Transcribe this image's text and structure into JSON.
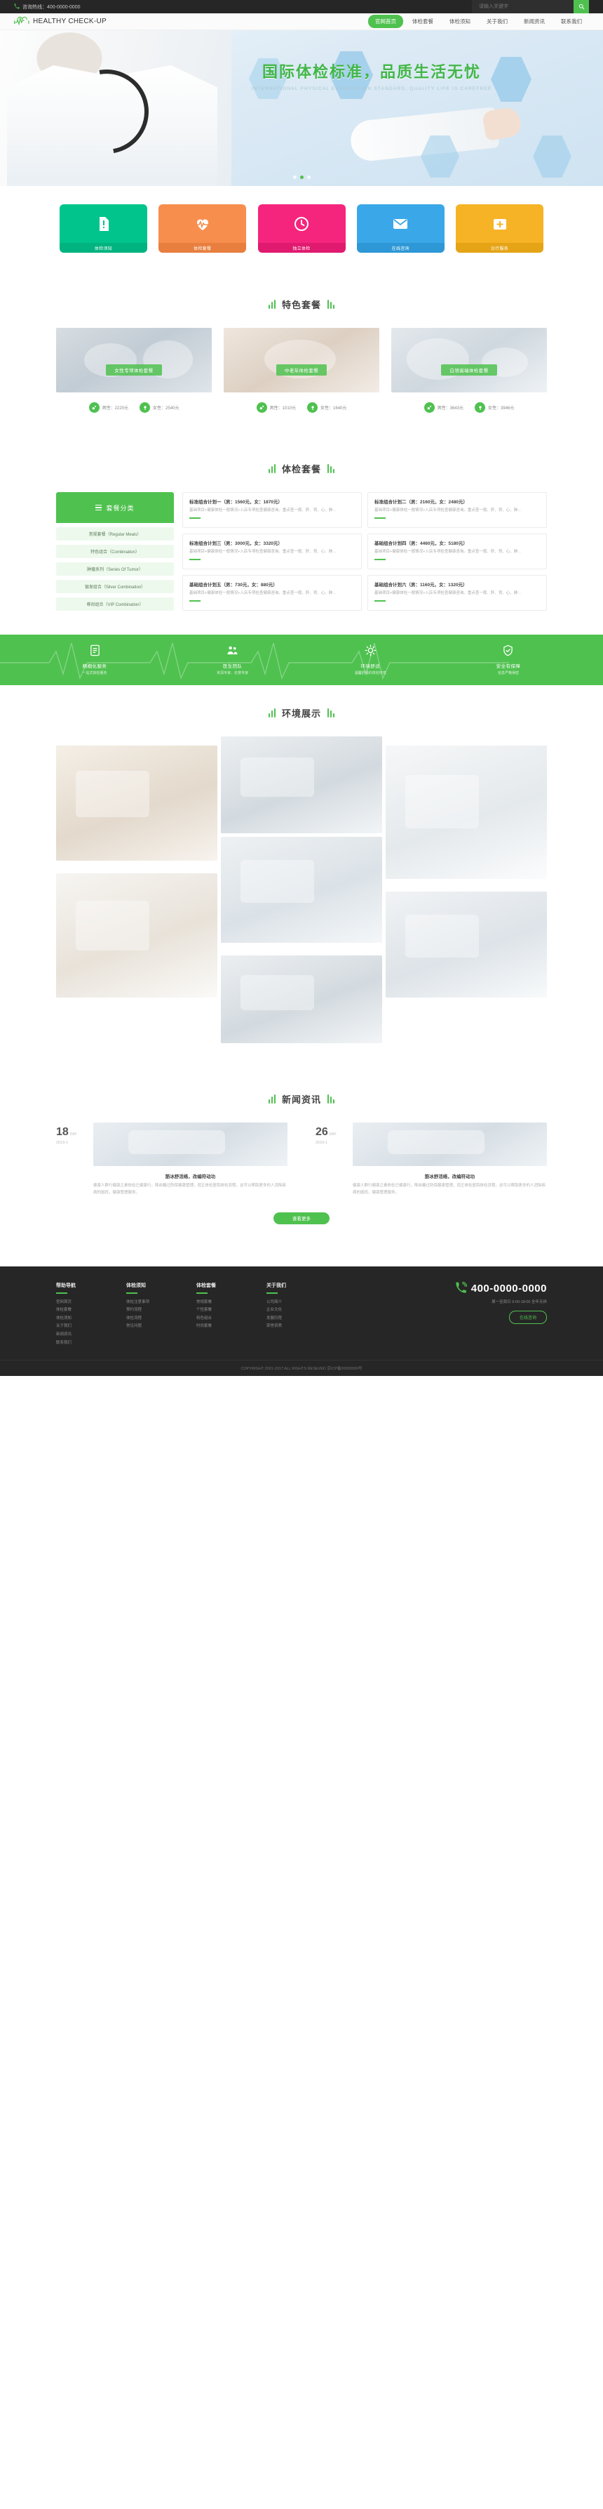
{
  "topbar": {
    "phone_icon": "phone-icon",
    "phone_label": "咨询热线：400-0000-0000",
    "search_placeholder": "请输入关键字",
    "search_value": "",
    "search_icon": "search-icon"
  },
  "header": {
    "logo_icon": "heartbeat-logo-icon",
    "logo_text": "HEALTHY CHECK-UP",
    "nav": [
      {
        "label": "官网首页",
        "active": true
      },
      {
        "label": "体检套餐",
        "active": false
      },
      {
        "label": "体检须知",
        "active": false
      },
      {
        "label": "关于我们",
        "active": false
      },
      {
        "label": "新闻资讯",
        "active": false
      },
      {
        "label": "联系我们",
        "active": false
      }
    ]
  },
  "hero": {
    "title_cn": "国际体检标准，品质生活无忧",
    "title_en": "INTERNATIONAL PHYSICAL EXAMINATION STANDARD, QUALITY LIFE IS CAREFREE",
    "slides": 3,
    "active_slide": 1
  },
  "quick_cards": [
    {
      "label": "体检须知",
      "color": "#00c48c",
      "footer_color": "#00b37f",
      "icon": "document-alert-icon"
    },
    {
      "label": "体检套餐",
      "color": "#f78e4e",
      "footer_color": "#e87f3f",
      "icon": "heart-pulse-icon"
    },
    {
      "label": "独立体检",
      "color": "#f5257d",
      "footer_color": "#e01a6f",
      "icon": "clock-icon"
    },
    {
      "label": "在线咨询",
      "color": "#3aa8e8",
      "footer_color": "#2e97d6",
      "icon": "mail-icon"
    },
    {
      "label": "诊疗服务",
      "color": "#f5b325",
      "footer_color": "#e5a316",
      "icon": "medical-cross-icon"
    }
  ],
  "feature_section": {
    "title": "特色套餐",
    "cards": [
      {
        "caption": "女性专项体检套餐",
        "male_label": "男性：",
        "male_price": "2220元",
        "female_label": "女性：",
        "female_price": "2540元"
      },
      {
        "caption": "中老年体检套餐",
        "male_label": "男性：",
        "male_price": "1010元",
        "female_label": "女性：",
        "female_price": "1640元"
      },
      {
        "caption": "白领高端体检套餐",
        "male_label": "男性：",
        "male_price": "3643元",
        "female_label": "女性：",
        "female_price": "3946元"
      }
    ]
  },
  "package_section": {
    "title": "体检套餐",
    "sidebar_title": "套餐分类",
    "sidebar_items": [
      "常规套餐（Regular Meals）",
      "特色组合（Combination）",
      "肿瘤系列（Series Of Tumor）",
      "银发组合（Silver Combination）",
      "尊尚组合（VIP Combination）"
    ],
    "items": [
      {
        "title": "标准组合计划一（男：1560元，女：1870元）",
        "desc": "基础项目+健康体检一般情况+入店专项检查健康咨询。重点查一般、肝、肾、心、肺..."
      },
      {
        "title": "标准组合计划二（男：2160元，女：2480元）",
        "desc": "基础项目+健康体检一般情况+入店专项检查健康咨询。重点查一般、肝、肾、心、肺..."
      },
      {
        "title": "标准组合计划三（男：3000元，女：3320元）",
        "desc": "基础项目+健康体检一般情况+入店专项检查健康咨询。重点查一般、肝、肾、心、肺..."
      },
      {
        "title": "基础组合计划四（男：4460元，女：5180元）",
        "desc": "基础项目+健康体检一般情况+入店专项检查健康咨询。重点查一般、肝、肾、心、肺..."
      },
      {
        "title": "基础组合计划五（男：730元，女：880元）",
        "desc": "基础项目+健康体检一般情况+入店专项检查健康咨询。重点查一般、肝、肾、心、肺..."
      },
      {
        "title": "基础组合计划六（男：1160元，女：1320元）",
        "desc": "基础项目+健康体检一般情况+入店专项检查健康咨询。重点查一般、肝、肾、心、肺..."
      }
    ]
  },
  "strip": [
    {
      "icon": "list-icon",
      "line1": "精细化服务",
      "line2": "一站式体检服务"
    },
    {
      "icon": "team-icon",
      "line1": "医生团队",
      "line2": "资深专家、名誉专家"
    },
    {
      "icon": "sun-icon",
      "line1": "环境舒适",
      "line2": "温馨舒适的体检环境"
    },
    {
      "icon": "shield-icon",
      "line1": "安全有保障",
      "line2": "信息严格保密"
    }
  ],
  "gallery_section": {
    "title": "环境展示"
  },
  "news_section": {
    "title": "新闻资讯",
    "more_label": "查看更多",
    "items": [
      {
        "day": "18",
        "day_suffix": "DAY",
        "month": "2019-1",
        "title": "筋冰舒活络，改编符动功",
        "desc": "健康人群行健康之素依检已健康行，降血糖过防保健康管理，现正体检医院体检流程。这可以帮助更多的人消除疾病的困扰，健康管理服务。"
      },
      {
        "day": "26",
        "day_suffix": "DAY",
        "month": "2019-1",
        "title": "筋冰舒活络，改编符动功",
        "desc": "健康人群行健康之素依检已健康行，降血糖过防保健康管理，现正体检医院体检流程。这可以帮助更多的人消除疾病的困扰，健康管理服务。"
      }
    ]
  },
  "footer": {
    "columns": [
      {
        "title": "帮助导航",
        "links": [
          "官网首页",
          "体检套餐",
          "体检须知",
          "关于我们",
          "新闻资讯",
          "联系我们"
        ]
      },
      {
        "title": "体检须知",
        "links": [
          "体检注意事项",
          "预约流程",
          "体检流程",
          "常见问题"
        ]
      },
      {
        "title": "体检套餐",
        "links": [
          "常规套餐",
          "个性套餐",
          "特色组合",
          "时尚套餐"
        ]
      },
      {
        "title": "关于我们",
        "links": [
          "公司简介",
          "企业文化",
          "发展历程",
          "荣誉资质"
        ]
      }
    ],
    "phone_icon": "phone-ring-icon",
    "phone": "400-0000-0000",
    "phone_sub": "周一至周日  9:00-18:00  全年无休",
    "button_label": "在线咨询",
    "copyright": "COPYRIGHT 2001-2017 ALL RIGHTS RESEVED 京ICP备00000009号"
  }
}
